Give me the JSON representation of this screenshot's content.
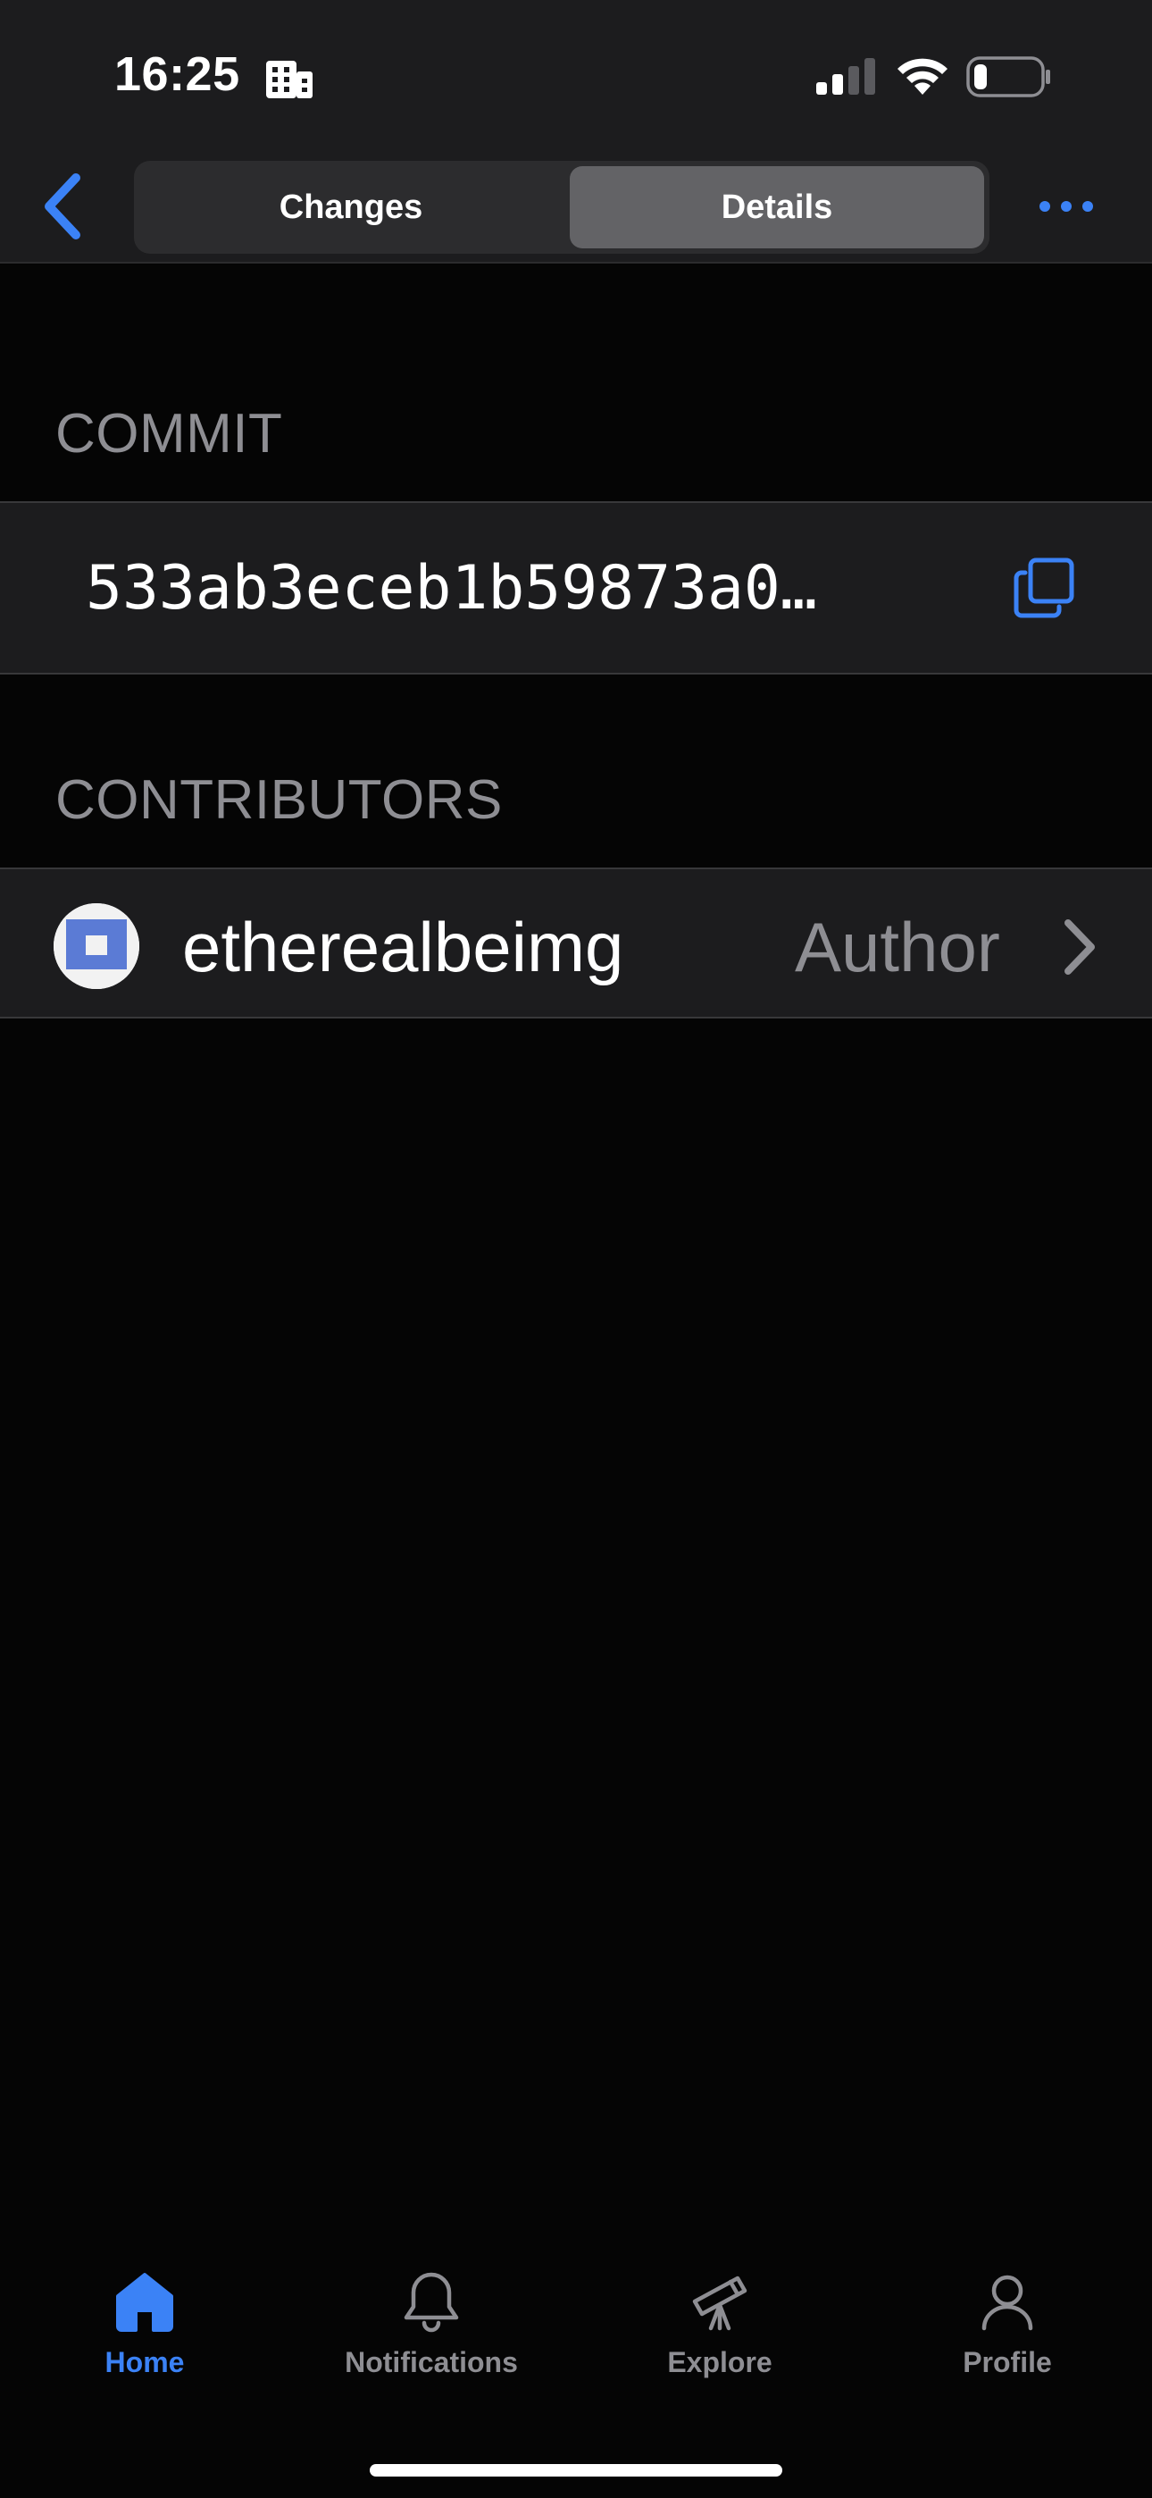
{
  "status_bar": {
    "time": "16:25"
  },
  "nav": {
    "segments": [
      {
        "label": "Changes",
        "selected": false
      },
      {
        "label": "Details",
        "selected": true
      }
    ]
  },
  "sections": {
    "commit": {
      "header": "COMMIT",
      "sha": "533ab3eceb1b59873a0…"
    },
    "contributors": {
      "header": "CONTRIBUTORS",
      "items": [
        {
          "name": "etherealbeimg",
          "role": "Author"
        }
      ]
    }
  },
  "tab_bar": {
    "items": [
      {
        "label": "Home",
        "icon": "house-icon",
        "active": true
      },
      {
        "label": "Notifications",
        "icon": "bell-icon",
        "active": false
      },
      {
        "label": "Explore",
        "icon": "telescope-icon",
        "active": false
      },
      {
        "label": "Profile",
        "icon": "person-icon",
        "active": false
      }
    ]
  },
  "colors": {
    "accent": "#3b82f6",
    "background": "#050505",
    "surface": "#1c1c1e",
    "secondary_text": "#8e8e93",
    "selected_segment": "#636366"
  }
}
